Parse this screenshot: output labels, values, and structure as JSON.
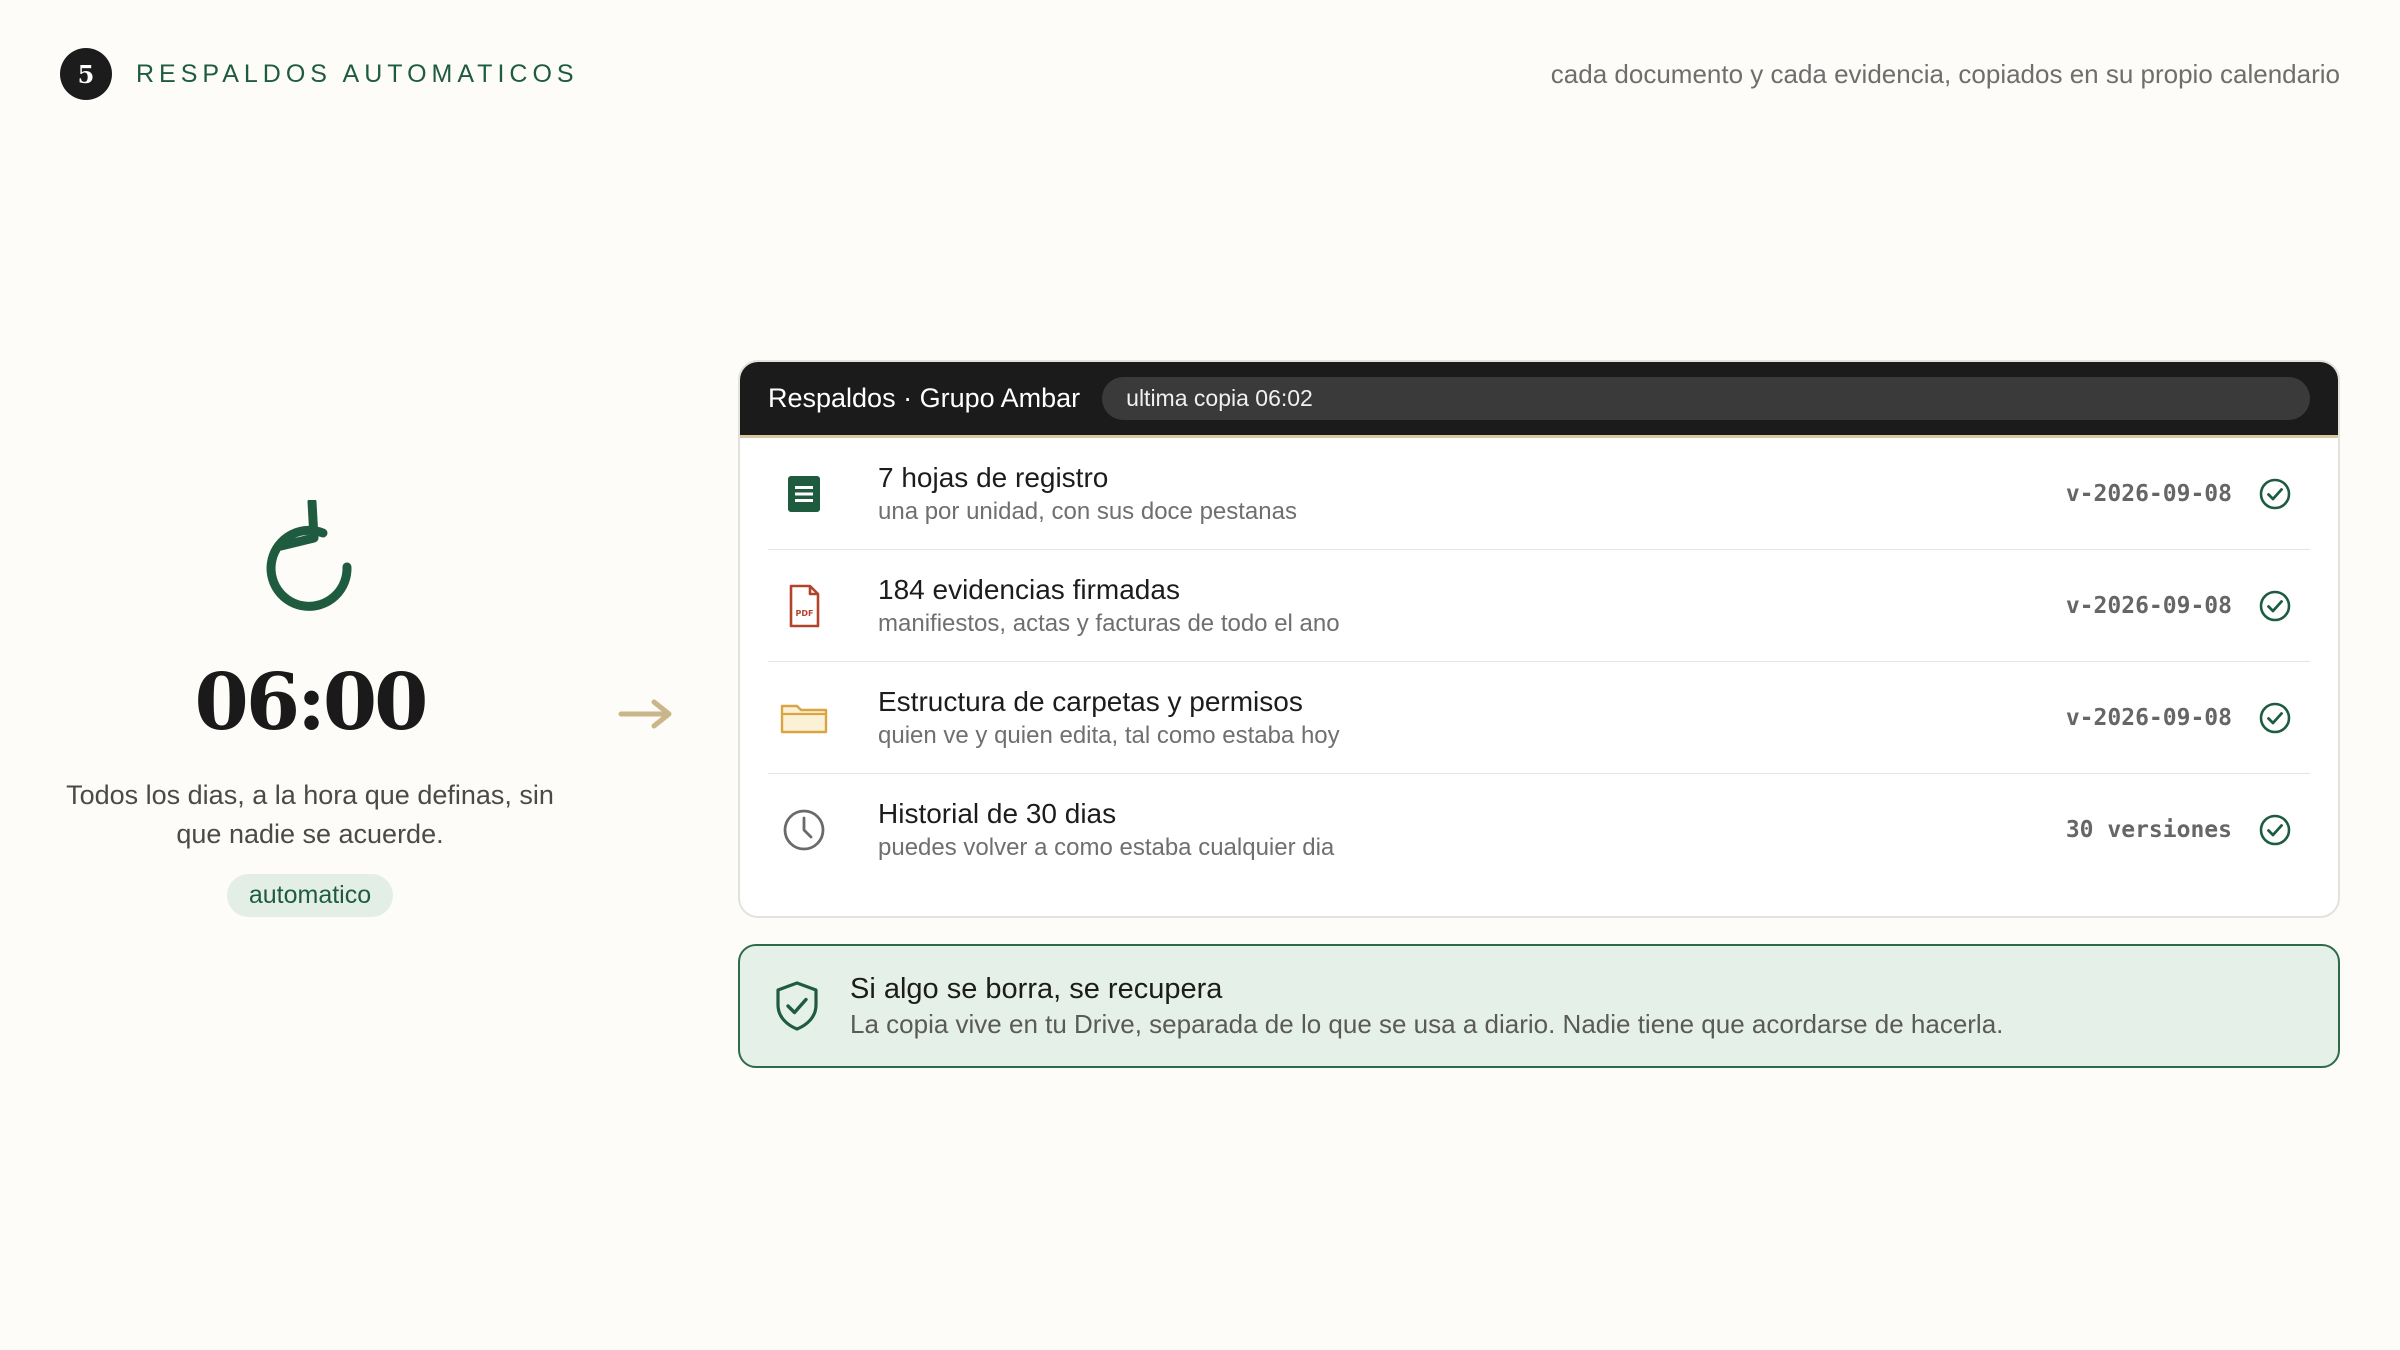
{
  "header": {
    "step_number": "5",
    "section_title": "RESPALDOS AUTOMATICOS",
    "subtitle": "cada documento y cada evidencia, copiados en su propio calendario"
  },
  "left": {
    "icon": "refresh-icon",
    "time": "06:00",
    "description_line1": "Todos los dias, a la hora que definas, sin",
    "description_line2": "que nadie se acuerde.",
    "pill": "automatico"
  },
  "card": {
    "title": "Respaldos · Grupo Ambar",
    "status": "ultima copia 06:02",
    "rows": [
      {
        "icon": "sheet-icon",
        "title": "7 hojas de registro",
        "subtitle": "una por unidad, con sus doce pestanas",
        "version": "v-2026-09-08",
        "status_icon": "check-circle-icon"
      },
      {
        "icon": "pdf-icon",
        "title": "184 evidencias firmadas",
        "subtitle": "manifiestos, actas y facturas de todo el ano",
        "version": "v-2026-09-08",
        "status_icon": "check-circle-icon"
      },
      {
        "icon": "folder-icon",
        "title": "Estructura de carpetas y permisos",
        "subtitle": "quien ve y quien edita, tal como estaba hoy",
        "version": "v-2026-09-08",
        "status_icon": "check-circle-icon"
      },
      {
        "icon": "clock-icon",
        "title": "Historial de 30 dias",
        "subtitle": "puedes volver a como estaba cualquier dia",
        "version": "30 versiones",
        "status_icon": "check-circle-icon"
      }
    ]
  },
  "note": {
    "icon": "shield-check-icon",
    "title": "Si algo se borra, se recupera",
    "description": "La copia vive en tu Drive, separada de lo que se usa a diario. Nadie tiene que acordarse de hacerla."
  },
  "colors": {
    "background": "#fdfcf8",
    "accent_green": "#1f5c3f",
    "card_header": "#1b1b1b",
    "note_background": "#e5f0e8",
    "arrow": "#c9b68a",
    "pdf_red": "#b2442c",
    "folder_gold": "#d9a441"
  }
}
